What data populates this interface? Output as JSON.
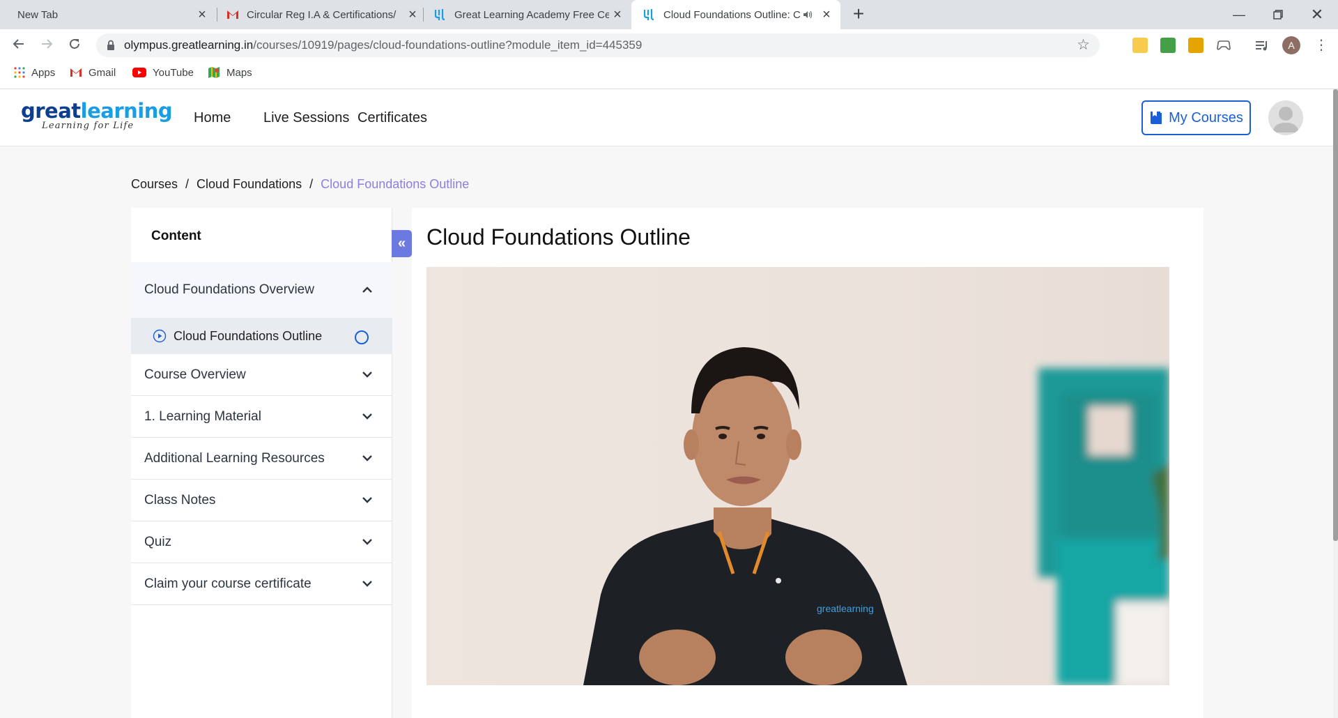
{
  "browser": {
    "tabs": [
      {
        "title": "New Tab",
        "favicon": "none"
      },
      {
        "title": "Circular Reg I.A & Certifications/",
        "favicon": "gmail-icon"
      },
      {
        "title": "Great Learning Academy Free Ce",
        "favicon": "great-learning-icon"
      },
      {
        "title": "Cloud Foundations Outline: C",
        "favicon": "great-learning-icon",
        "active": true,
        "audio": true
      }
    ],
    "url_host": "olympus.greatlearning.in",
    "url_path": "/courses/10919/pages/cloud-foundations-outline?module_item_id=445359",
    "profile_initial": "A",
    "bookmarks": [
      {
        "label": "Apps",
        "icon": "apps-grid-icon"
      },
      {
        "label": "Gmail",
        "icon": "gmail-icon"
      },
      {
        "label": "YouTube",
        "icon": "youtube-icon"
      },
      {
        "label": "Maps",
        "icon": "maps-icon"
      }
    ]
  },
  "site": {
    "logo_word_1": "great",
    "logo_word_2": "learning",
    "logo_tagline": "Learning for Life",
    "nav": [
      "Home",
      "Live Sessions",
      "Certificates"
    ],
    "my_courses_label": "My Courses"
  },
  "breadcrumb": {
    "items": [
      "Courses",
      "Cloud Foundations"
    ],
    "current": "Cloud Foundations Outline",
    "separator": "/"
  },
  "sidebar": {
    "heading": "Content",
    "open_section": "Cloud Foundations Overview",
    "open_items": [
      {
        "label": "Cloud Foundations Outline",
        "type": "video"
      }
    ],
    "sections": [
      "Course Overview",
      "1. Learning Material",
      "Additional Learning Resources",
      "Class Notes",
      "Quiz",
      "Claim your course certificate"
    ]
  },
  "main": {
    "title": "Cloud Foundations Outline",
    "video_shirt_brand": "greatlearning"
  },
  "colors": {
    "brand_blue": "#1a5fd6",
    "breadcrumb_current": "#8b7fe0",
    "collapse_button": "#6c79e0",
    "video_teal": "#1a9a98"
  }
}
